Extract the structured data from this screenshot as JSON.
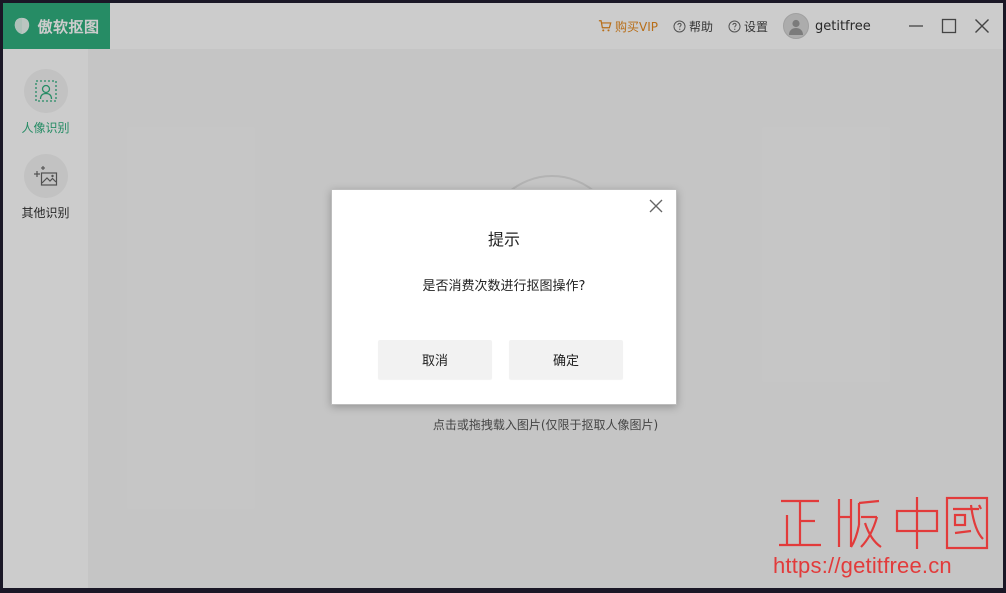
{
  "app": {
    "name": "傲软抠图",
    "accent_color": "#30b07f",
    "vip_color": "#e68a1f"
  },
  "header": {
    "vip_label": "购买VIP",
    "help_label": "帮助",
    "settings_label": "设置",
    "username": "getitfree"
  },
  "sidebar": {
    "items": [
      {
        "label": "人像识别",
        "icon": "portrait-select-icon",
        "active": true
      },
      {
        "label": "其他识别",
        "icon": "image-add-icon",
        "active": false
      }
    ]
  },
  "main": {
    "upload_hint": "点击或拖拽载入图片(仅限于抠取人像图片)"
  },
  "dialog": {
    "title": "提示",
    "message": "是否消费次数进行抠图操作?",
    "cancel_label": "取消",
    "confirm_label": "确定"
  },
  "watermark": {
    "url": "https://getitfree.cn",
    "seal_text": "正版中国"
  }
}
